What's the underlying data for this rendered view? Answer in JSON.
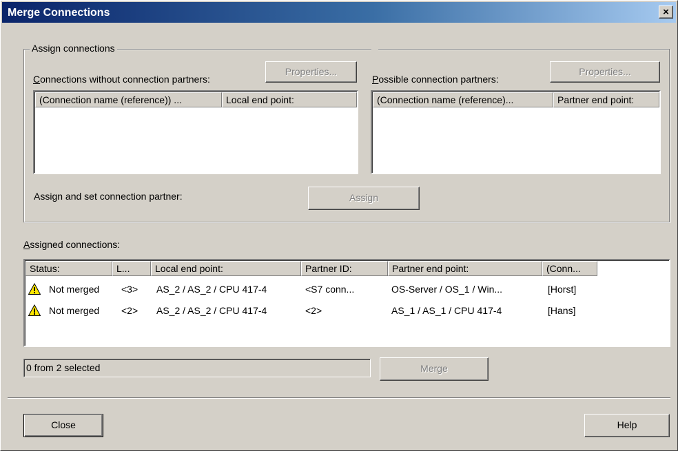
{
  "window": {
    "title": "Merge Connections",
    "close_glyph": "×"
  },
  "assign_group": {
    "legend": "Assign connections",
    "left": {
      "label_mnemonic": "C",
      "label_rest": "onnections without connection partners:",
      "properties_button": "Properties...",
      "columns": [
        "(Connection name (reference)) ...",
        "Local end point:"
      ],
      "rows": []
    },
    "right": {
      "label_mnemonic": "P",
      "label_rest": "ossible connection partners:",
      "properties_button": "Properties...",
      "columns": [
        "(Connection name (reference)...",
        "Partner end point:"
      ],
      "rows": []
    },
    "assign_label": "Assign and set connection partner:",
    "assign_button": "Assign"
  },
  "assigned": {
    "label_mnemonic": "A",
    "label_rest": "ssigned connections:",
    "columns": [
      "Status:",
      "L...",
      "Local end point:",
      "Partner ID:",
      "Partner end point:",
      "(Conn..."
    ],
    "rows": [
      {
        "status": "Not merged",
        "l": "<3>",
        "local": "AS_2 / AS_2 / CPU 417-4",
        "partner_id": "<S7 conn...",
        "partner_end": "OS-Server / OS_1 / Win...",
        "conn": "[Horst]",
        "icon": "warning-icon"
      },
      {
        "status": "Not merged",
        "l": "<2>",
        "local": "AS_2 / AS_2 / CPU 417-4",
        "partner_id": "<2>",
        "partner_end": "AS_1 / AS_1 / CPU 417-4",
        "conn": "[Hans]",
        "icon": "warning-icon"
      }
    ]
  },
  "selection_status": "0 from 2 selected",
  "merge_button": "Merge",
  "close_button": "Close",
  "help_button": "Help",
  "colors": {
    "dialog_bg": "#d4d0c8",
    "title_gradient_start": "#0a246a",
    "title_gradient_end": "#a6caf0",
    "warning_yellow": "#ffe600"
  }
}
